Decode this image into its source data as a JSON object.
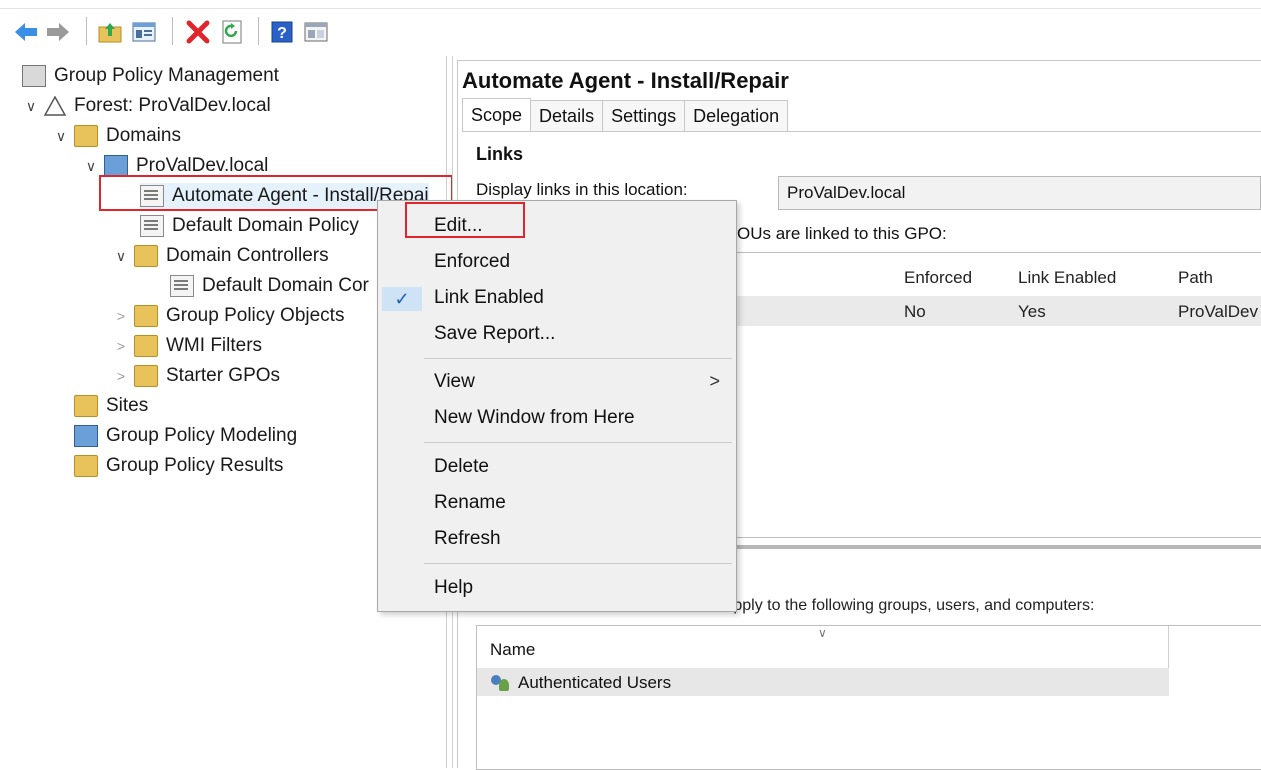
{
  "toolbar": {
    "icons": [
      "back-arrow-icon",
      "forward-arrow-icon",
      "up-folder-icon",
      "show-hide-console-tree-icon",
      "delete-icon",
      "refresh-icon",
      "help-icon",
      "console-view-icon"
    ],
    "colors": {
      "back": "#3a8ee6",
      "delete": "#e0262c",
      "refresh": "#2fa84f",
      "help": "#2a61c9"
    }
  },
  "tree": {
    "root": "Group Policy Management",
    "forest": "Forest: ProValDev.local",
    "domains": "Domains",
    "domain": "ProValDev.local",
    "gpo_selected": "Automate Agent - Install/Repai",
    "default_domain_policy": "Default Domain Policy",
    "domain_controllers": "Domain Controllers",
    "default_domain_controllers": "Default Domain Cor",
    "group_policy_objects": "Group Policy Objects",
    "wmi_filters": "WMI Filters",
    "starter_gpos": "Starter GPOs",
    "sites": "Sites",
    "modeling": "Group Policy Modeling",
    "results": "Group Policy Results"
  },
  "right": {
    "title": "Automate Agent - Install/Repair",
    "tabs": [
      "Scope",
      "Details",
      "Settings",
      "Delegation"
    ],
    "links_heading": "Links",
    "display_label": "Display links in this location:",
    "display_value": "ProValDev.local",
    "linked_label": "OUs are linked to this GPO:",
    "links_columns": {
      "enforced": "Enforced",
      "link_enabled": "Link Enabled",
      "path": "Path"
    },
    "links_rows": [
      {
        "enforced": "No",
        "link_enabled": "Yes",
        "path": "ProValDev"
      }
    ],
    "filter_text": "apply to the following groups, users, and computers:",
    "security_column": "Name",
    "security_rows": [
      "Authenticated Users"
    ]
  },
  "context_menu": {
    "items": [
      {
        "label": "Edit..."
      },
      {
        "label": "Enforced"
      },
      {
        "label": "Link Enabled",
        "checked": true
      },
      {
        "label": "Save Report..."
      },
      {
        "label": "View",
        "submenu": true
      },
      {
        "label": "New Window from Here"
      },
      {
        "label": "Delete"
      },
      {
        "label": "Rename"
      },
      {
        "label": "Refresh"
      },
      {
        "label": "Help"
      }
    ],
    "check_glyph": "✓",
    "submenu_glyph": ">"
  },
  "highlight_color": "#e0262c"
}
